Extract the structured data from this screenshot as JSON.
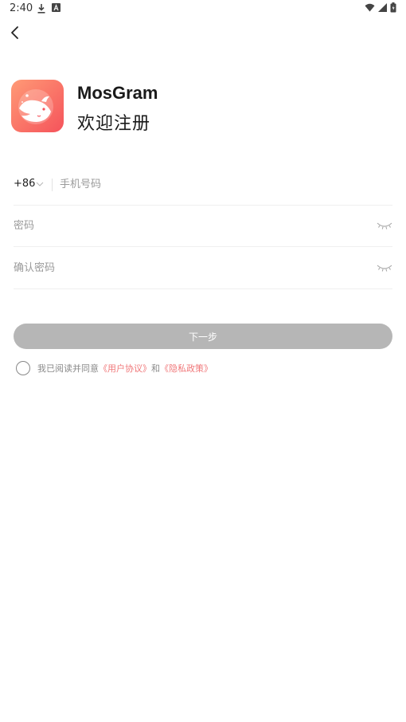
{
  "status_bar": {
    "time": "2:40"
  },
  "app": {
    "name": "MosGram",
    "welcome": "欢迎注册"
  },
  "form": {
    "country_code": "+86",
    "phone_placeholder": "手机号码",
    "password_placeholder": "密码",
    "confirm_placeholder": "确认密码"
  },
  "actions": {
    "next_label": "下一步"
  },
  "agreement": {
    "prefix": "我已阅读并同意",
    "user_agreement": "《用户协议》",
    "conjunction": "和",
    "privacy_policy": "《隐私政策》"
  },
  "colors": {
    "logo_gradient_start": "#ff9a76",
    "logo_gradient_end": "#f5535b",
    "link": "#f0787a",
    "button_disabled": "#b6b6b6"
  }
}
